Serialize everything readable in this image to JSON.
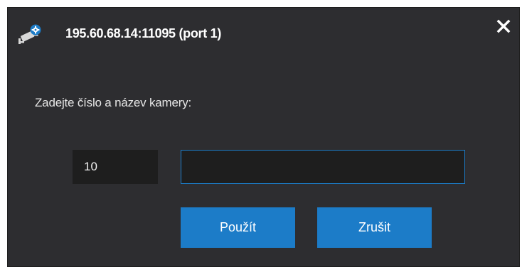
{
  "dialog": {
    "title": "195.60.68.14:11095 (port 1)",
    "title_icon": "camera-settings-icon",
    "close_icon": "close-icon",
    "prompt": "Zadejte číslo a název kamery:",
    "camera_number": "10",
    "camera_name": "",
    "apply_label": "Použít",
    "cancel_label": "Zrušit"
  },
  "colors": {
    "background": "#2d2d30",
    "field_background": "#1e1e1e",
    "accent": "#1c7cc8",
    "text": "#ffffff"
  }
}
